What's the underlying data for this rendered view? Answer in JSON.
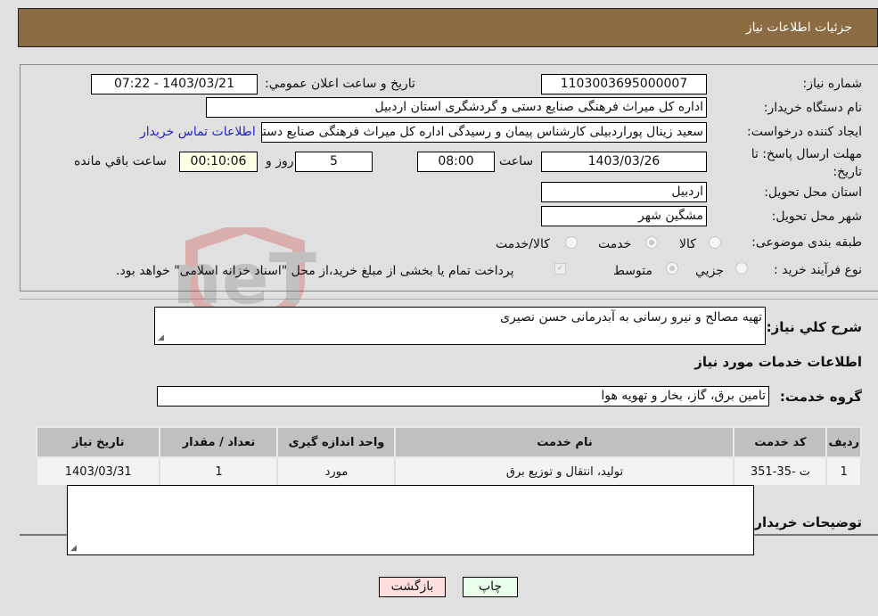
{
  "header": {
    "title": "جزئیات اطلاعات نیاز"
  },
  "form": {
    "need_number_label": "شماره نیاز:",
    "need_number": "1103003695000007",
    "announce_label": "تاریخ و ساعت اعلان عمومي:",
    "announce_value": "1403/03/21 - 07:22",
    "buyer_org_label": "نام دستگاه خریدار:",
    "buyer_org": "اداره کل میراث فرهنگی  صنایع دستی و گردشگری استان اردبیل",
    "creator_label": "ایجاد کننده درخواست:",
    "creator": "سعید زینال پوراردبیلی کارشناس پیمان و رسیدگی اداره کل میراث فرهنگی  صنایع دستی و گردشگری استان اردبیل",
    "contact_link": "اطلاعات تماس خریدار",
    "deadline_label": "مهلت ارسال پاسخ: تا تاریخ:",
    "deadline_date": "1403/03/26",
    "time_label": "ساعت",
    "deadline_time": "08:00",
    "days_value": "5",
    "days_label": "روز و",
    "remaining_value": "00:10:06",
    "remaining_label": "ساعت باقي مانده",
    "province_label": "استان محل تحویل:",
    "province": "اردبیل",
    "city_label": "شهر محل تحویل:",
    "city": "مشگین شهر",
    "category_label": "طبقه بندی موضوعی:",
    "category_options": [
      "کالا",
      "خدمت",
      "کالا/خدمت"
    ],
    "category_selected": "خدمت",
    "process_label": "نوع فرآیند خرید :",
    "process_options": [
      "جزیي",
      "متوسط"
    ],
    "process_selected": "متوسط",
    "treasury_note": "پرداخت تمام یا بخشی از مبلغ خرید،از محل \"اسناد خزانه اسلامی\" خواهد بود."
  },
  "details": {
    "summary_label": "شرح کلي نیاز:",
    "summary": "تهیه مصالح و نیرو رسانی به آبدرمانی حسن نصیری",
    "services_heading": "اطلاعات خدمات مورد نیاز",
    "group_label": "گروه خدمت:",
    "group_value": "تامین برق، گاز، بخار و تهویه هوا",
    "table": {
      "headers": [
        "ردیف",
        "کد خدمت",
        "نام خدمت",
        "واحد اندازه گیری",
        "تعداد / مقدار",
        "تاریخ نیاز"
      ],
      "rows": [
        [
          "1",
          "ت -35-351",
          "تولید، انتقال و توزیع برق",
          "مورد",
          "1",
          "1403/03/31"
        ]
      ]
    },
    "buyer_notes_label": "توضیحات خریدار:",
    "buyer_notes": ""
  },
  "buttons": {
    "print": "چاپ",
    "back": "بازگشت"
  },
  "watermark": "AriaTender.neT"
}
